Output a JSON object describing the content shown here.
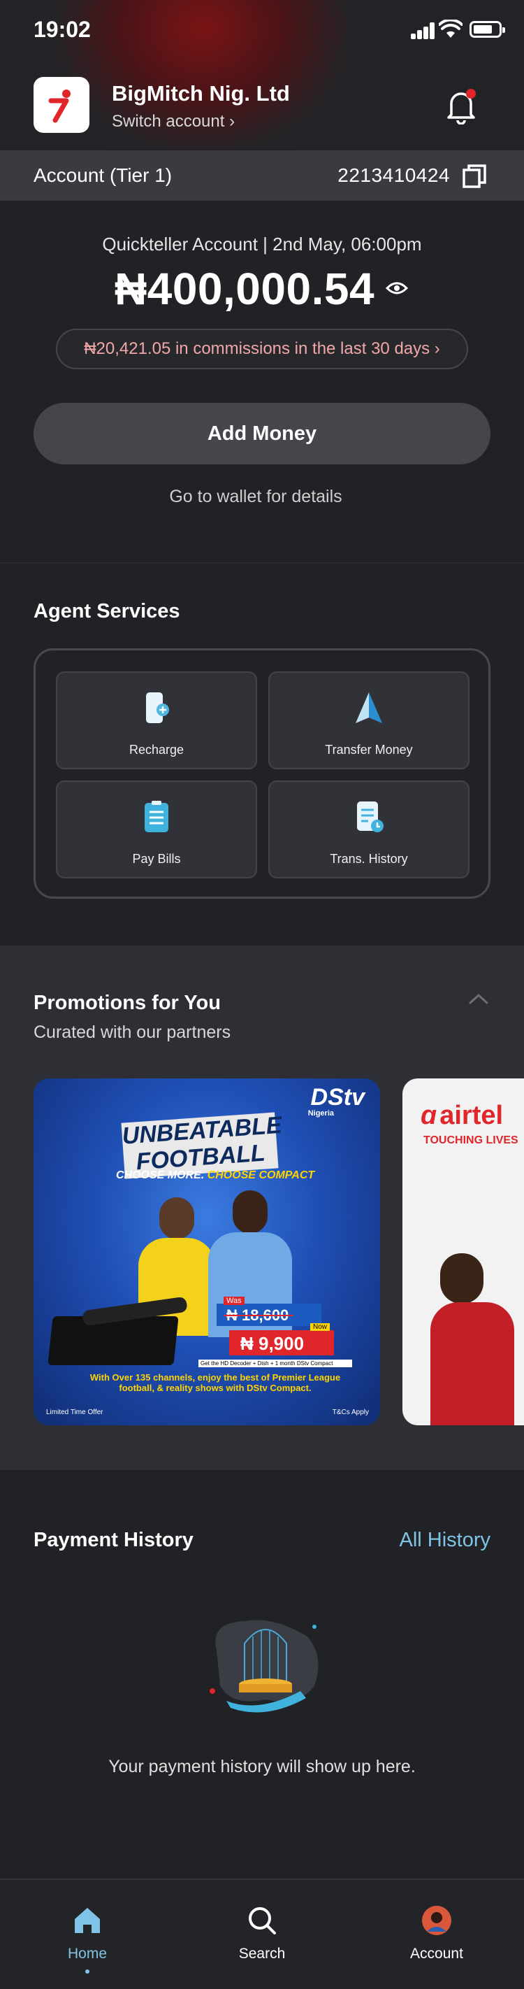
{
  "status_bar": {
    "time": "19:02"
  },
  "header": {
    "business_name": "BigMitch Nig. Ltd",
    "switch_account": "Switch account ›"
  },
  "account_bar": {
    "tier": "Account (Tier 1)",
    "account_number": "2213410424"
  },
  "balance_card": {
    "subtitle": "Quickteller Account | 2nd May, 06:00pm",
    "balance": "₦400,000.54",
    "commission": "₦20,421.05 in commissions in the last 30 days  ›",
    "add_money": "Add Money",
    "wallet_link": "Go to wallet for details"
  },
  "agent_services": {
    "title": "Agent Services",
    "items": [
      {
        "label": "Recharge",
        "icon": "phone-plus-icon"
      },
      {
        "label": "Transfer Money",
        "icon": "send-arrow-icon"
      },
      {
        "label": "Pay Bills",
        "icon": "bill-icon"
      },
      {
        "label": "Trans. History",
        "icon": "history-doc-icon"
      }
    ]
  },
  "promotions": {
    "title": "Promotions for You",
    "subtitle": "Curated with our partners",
    "banners": [
      {
        "brand": "DStv",
        "brand_sub": "Nigeria",
        "headline_1": "UNBEATABLE",
        "headline_2": "FOOTBALL",
        "tagline_a": "CHOOSE MORE.",
        "tagline_b": "CHOOSE COMPACT",
        "was_label": "Was",
        "was_price": "₦ 18,600",
        "now_label": "Now",
        "now_price": "₦ 9,900",
        "offer_detail": "Get the HD Decoder + Dish + 1 month DStv Compact",
        "body": "With Over 135 channels, enjoy the best of Premier League football, & reality shows with DStv Compact.",
        "footer_left": "Limited Time Offer",
        "footer_right": "T&Cs Apply"
      },
      {
        "brand": "airtel",
        "tagline": "TOUCHING LIVES"
      }
    ]
  },
  "payment_history": {
    "title": "Payment History",
    "all_history": "All History",
    "empty_text": "Your payment history will show up here."
  },
  "tabbar": {
    "items": [
      {
        "label": "Home",
        "icon": "home-icon",
        "active": true
      },
      {
        "label": "Search",
        "icon": "search-icon",
        "active": false
      },
      {
        "label": "Account",
        "icon": "avatar-icon",
        "active": false
      }
    ]
  },
  "colors": {
    "background": "#212226",
    "accent": "#7fc4e6",
    "commission_text": "#f1a7a7",
    "logo_red": "#e0262b"
  }
}
